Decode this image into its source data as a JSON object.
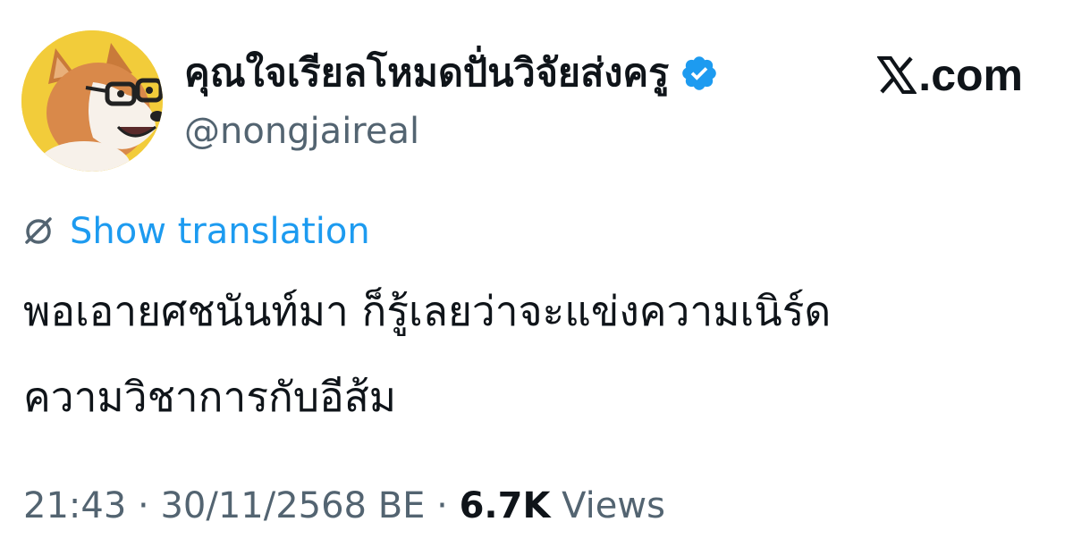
{
  "author": {
    "display_name": "คุณใจเรียลโหมดปั่นวิจัยส่งครู",
    "handle": "@nongjaireal",
    "verified": true,
    "avatar": "corgi-with-glasses"
  },
  "branding": {
    "domain": ".com",
    "logo_icon": "x-logo-icon"
  },
  "translation": {
    "icon": "globe-icon",
    "label": "Show translation"
  },
  "tweet": {
    "lines": [
      "พอเอายศชนันท์มา ก็รู้เลยว่าจะแข่งความเนิร์ด",
      "ความวิชาการกับอีส้ม"
    ]
  },
  "meta": {
    "time": "21:43",
    "separator": "·",
    "date": "30/11/2568 BE",
    "views_count": "6.7K",
    "views_label": "Views"
  },
  "colors": {
    "link": "#1d9bf0",
    "secondary_text": "#536471",
    "primary_text": "#0f1419",
    "verified_badge": "#1d9bf0",
    "avatar_background": "#f2cc3a"
  }
}
